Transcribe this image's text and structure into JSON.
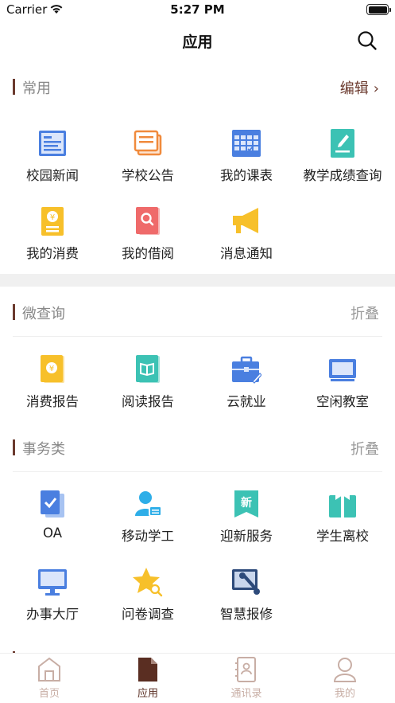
{
  "status_bar": {
    "carrier": "Carrier",
    "time": "5:27 PM"
  },
  "nav": {
    "title": "应用"
  },
  "sections": {
    "common": {
      "title": "常用",
      "action": "编辑",
      "items": [
        "校园新闻",
        "学校公告",
        "我的课表",
        "教学成绩查询",
        "我的消费",
        "我的借阅",
        "消息通知"
      ]
    },
    "query": {
      "title": "微查询",
      "action": "折叠",
      "items": [
        "消费报告",
        "阅读报告",
        "云就业",
        "空闲教室"
      ]
    },
    "affairs": {
      "title": "事务类",
      "action": "折叠",
      "items": [
        "OA",
        "移动学工",
        "迎新服务",
        "学生离校",
        "办事大厅",
        "问卷调查",
        "智慧报修"
      ]
    }
  },
  "tabs": [
    "首页",
    "应用",
    "通讯录",
    "我的"
  ],
  "active_tab": "应用",
  "colors": {
    "accent": "#6b3a2e",
    "tab_inactive": "#c8aea5",
    "blue": "#4a7fe0",
    "orange": "#f08a3c",
    "teal": "#3cc2b4",
    "yellow": "#f7c02a",
    "red": "#ef6a6a"
  }
}
